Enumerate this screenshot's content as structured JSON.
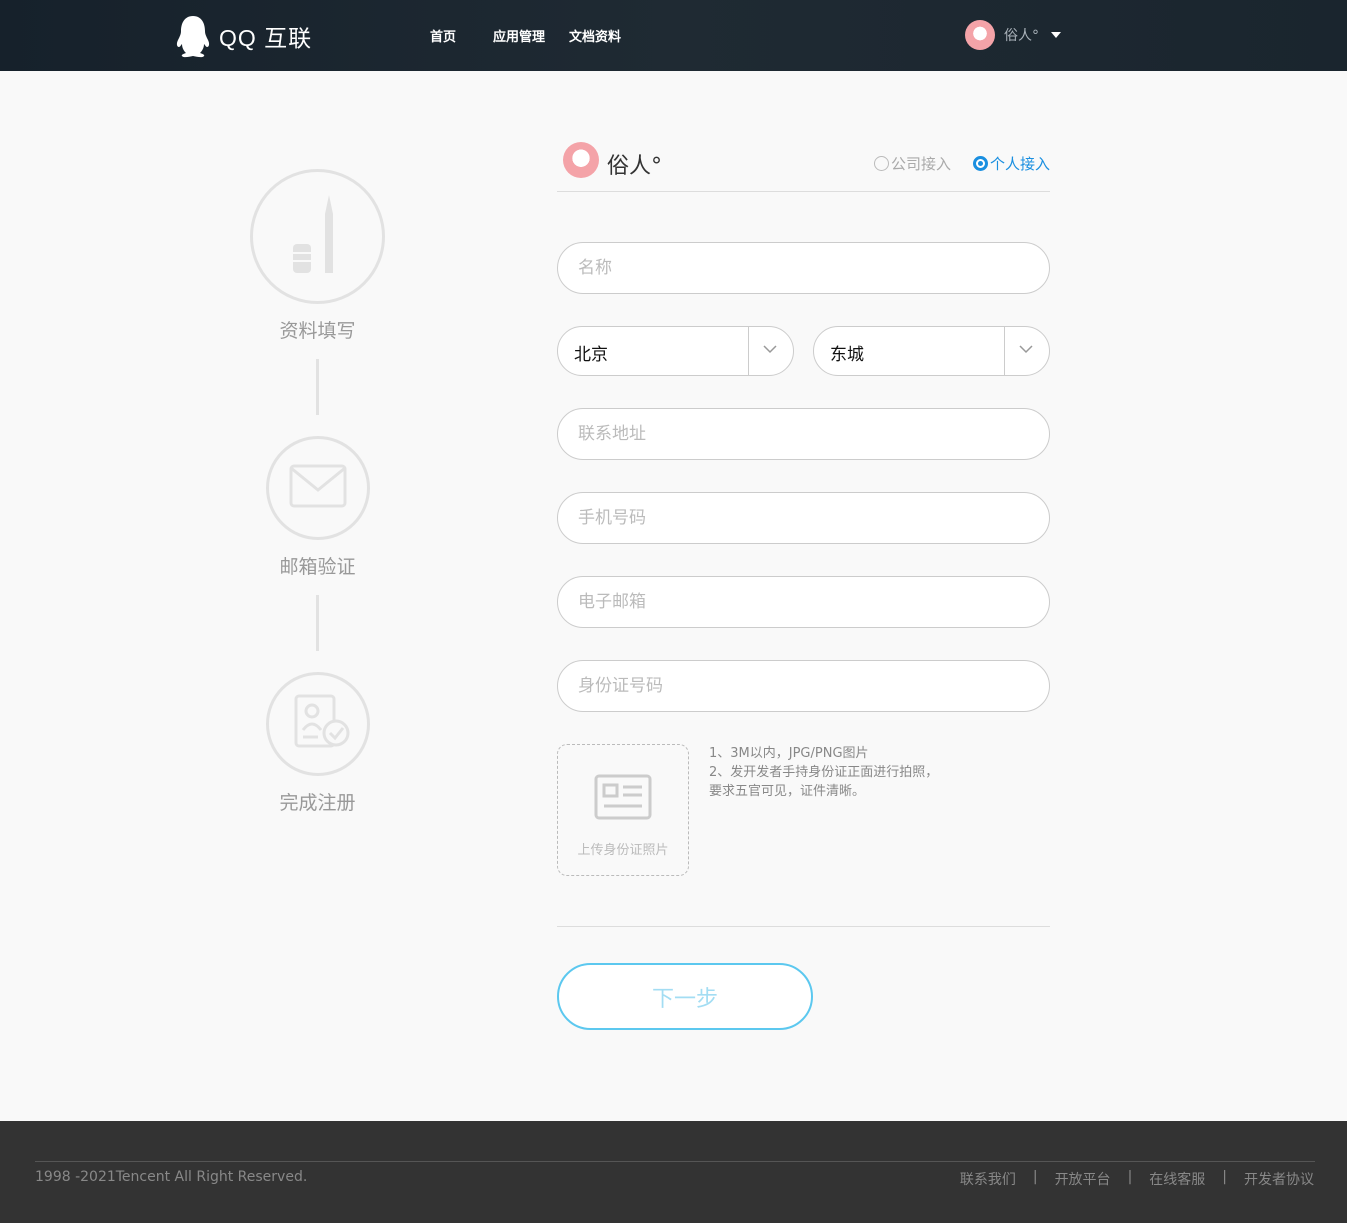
{
  "header": {
    "logo_text": "QQ 互联",
    "nav": [
      "首页",
      "应用管理",
      "文档资料"
    ],
    "username": "俗人°"
  },
  "steps": [
    {
      "label": "资料填写"
    },
    {
      "label": "邮箱验证"
    },
    {
      "label": "完成注册"
    }
  ],
  "form": {
    "username": "俗人°",
    "radio_company": "公司接入",
    "radio_personal": "个人接入",
    "name_placeholder": "名称",
    "province": "北京",
    "city": "东城",
    "address_placeholder": "联系地址",
    "phone_placeholder": "手机号码",
    "email_placeholder": "电子邮箱",
    "idcard_placeholder": "身份证号码",
    "upload_label": "上传身份证照片",
    "notes": [
      "1、3M以内，JPG/PNG图片",
      "2、发开发者手持身份证正面进行拍照，",
      "要求五官可见，证件清晰。"
    ],
    "next_button": "下一步"
  },
  "footer": {
    "copyright": "1998 -2021Tencent All Right Reserved.",
    "links": [
      "联系我们",
      "开放平台",
      "在线客服",
      "开发者协议"
    ],
    "separator": "|"
  },
  "colors": {
    "header_bg": "#1a252e",
    "accent_blue": "#1a8fe0",
    "button_border": "#5cc8ef",
    "footer_bg": "#333333"
  }
}
